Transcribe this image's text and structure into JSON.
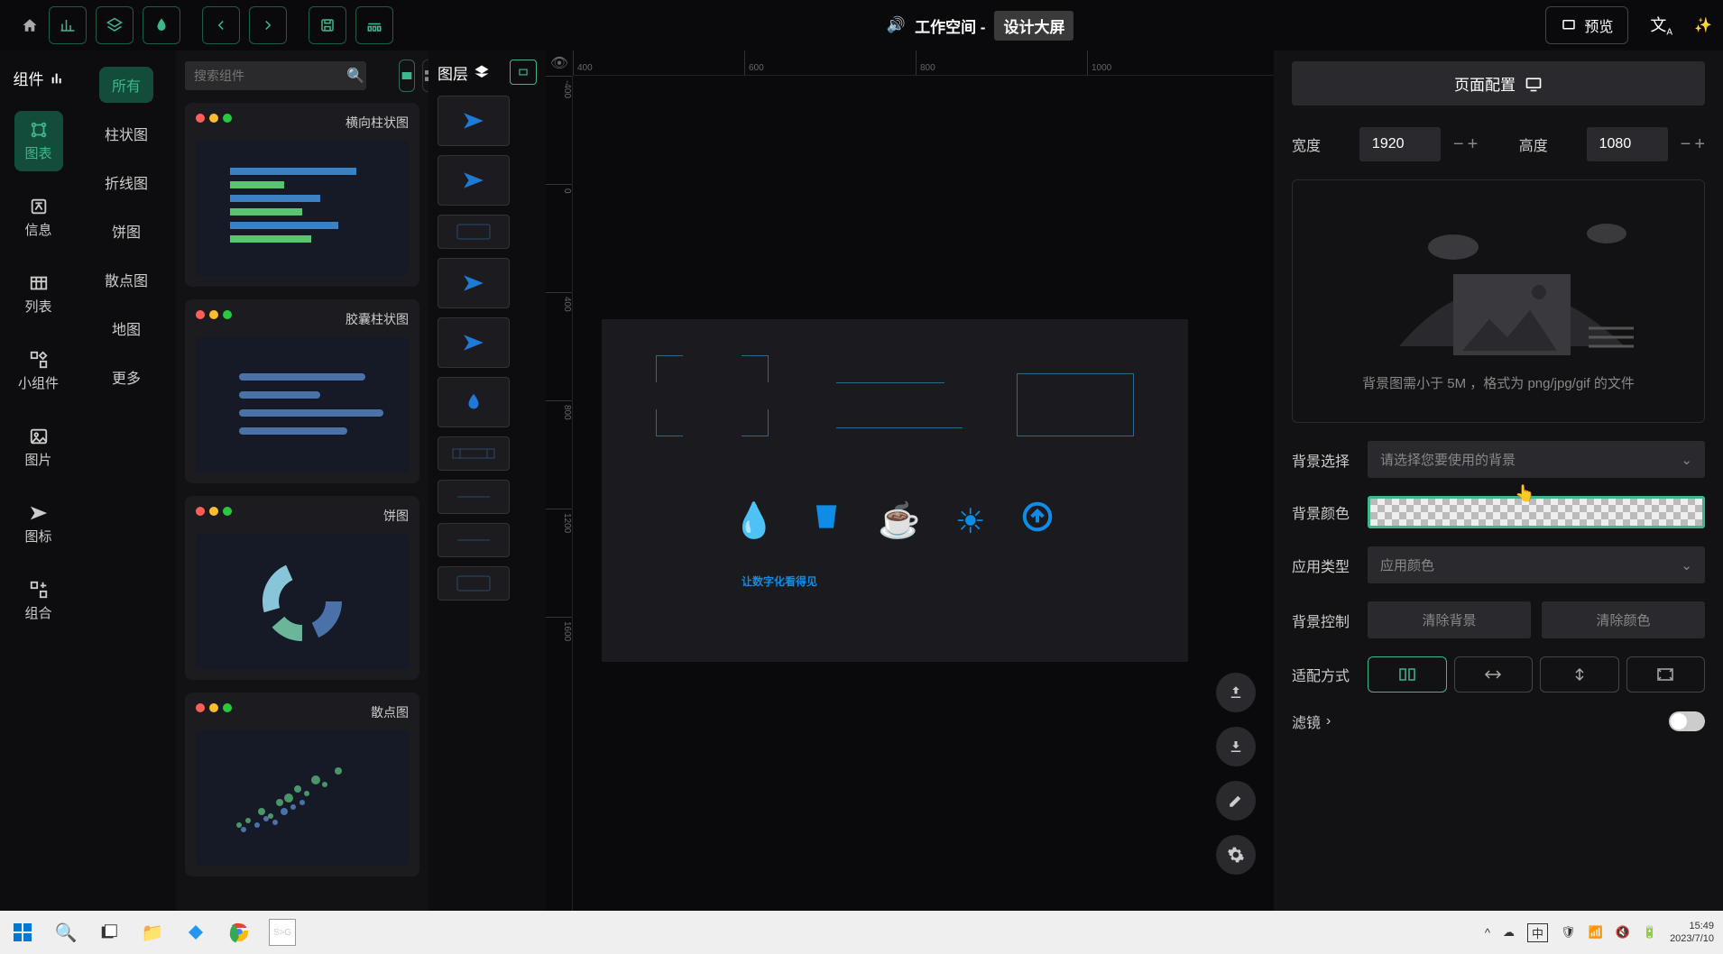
{
  "toolbar": {
    "workspace_label": "工作空间 - ",
    "title": "设计大屏",
    "preview": "预览"
  },
  "left_panel_head": "组件",
  "left_categories": [
    {
      "label": "图表",
      "active": true,
      "icon": "chart"
    },
    {
      "label": "信息",
      "icon": "text"
    },
    {
      "label": "列表",
      "icon": "table"
    },
    {
      "label": "小组件",
      "icon": "widget"
    },
    {
      "label": "图片",
      "icon": "image"
    },
    {
      "label": "图标",
      "icon": "plane"
    },
    {
      "label": "组合",
      "icon": "group"
    }
  ],
  "sub_categories": [
    "所有",
    "柱状图",
    "折线图",
    "饼图",
    "散点图",
    "地图",
    "更多"
  ],
  "comp_search_placeholder": "搜索组件",
  "components": [
    {
      "name": "横向柱状图"
    },
    {
      "name": "胶囊柱状图"
    },
    {
      "name": "饼图"
    },
    {
      "name": "散点图"
    }
  ],
  "layer_head": "图层",
  "ruler_h": [
    "400",
    "600",
    "800",
    "1000"
  ],
  "ruler_v": [
    "-400",
    "0",
    "400",
    "800",
    "1200",
    "1600"
  ],
  "canvas_text": "让数字化看得见",
  "right": {
    "tab": "页面配置",
    "width_lbl": "宽度",
    "width_val": "1920",
    "height_lbl": "高度",
    "height_val": "1080",
    "bg_hint": "背景图需小于 5M ，格式为 png/jpg/gif 的文件",
    "bg_select_lbl": "背景选择",
    "bg_select_ph": "请选择您要使用的背景",
    "bg_color_lbl": "背景颜色",
    "app_type_lbl": "应用类型",
    "app_type_val": "应用颜色",
    "bg_ctrl_lbl": "背景控制",
    "clear_bg": "清除背景",
    "clear_color": "清除颜色",
    "fit_lbl": "适配方式",
    "filter_lbl": "滤镜"
  },
  "taskbar": {
    "time": "15:49",
    "date": "2023/7/10",
    "ime": "中"
  }
}
